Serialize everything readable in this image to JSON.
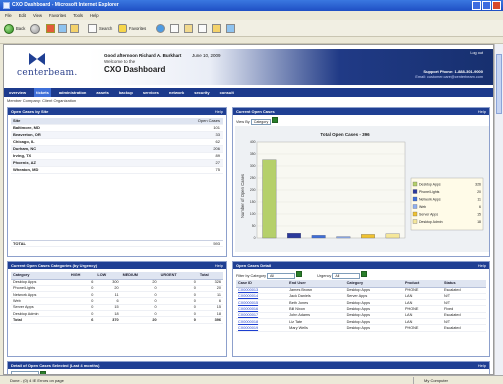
{
  "window": {
    "title": "CXO Dashboard - Microsoft Internet Explorer",
    "menu": [
      "File",
      "Edit",
      "View",
      "Favorites",
      "Tools",
      "Help"
    ]
  },
  "toolbar": {
    "back": "Back",
    "search": "Search",
    "favorites": "Favorites"
  },
  "header": {
    "logo": "centerbeam.",
    "greeting": "Good afternoon Richard A. Burkhart",
    "date": "June 10, 2009",
    "welcome": "Welcome to the",
    "title": "CXO Dashboard",
    "logout": "Log out",
    "support": "Support Phone: 1-888-301-9000",
    "email": "Email: customer.care@centerbeam.com"
  },
  "nav": [
    "overview",
    "tickets",
    "administration",
    "assets",
    "backup",
    "services",
    "network",
    "security",
    "consult"
  ],
  "breadcrumb": "Member Company: Client Organization",
  "panels": {
    "by_site": {
      "title": "Open Cases by Site",
      "help": "Help",
      "col_site": "Site",
      "col_count": "Open Cases",
      "rows": [
        {
          "site": "Baltimore, MD",
          "count": "101"
        },
        {
          "site": "Beaverton, OR",
          "count": "33"
        },
        {
          "site": "Chicago, IL",
          "count": "62"
        },
        {
          "site": "Durham, NC",
          "count": "206"
        },
        {
          "site": "Irving, TX",
          "count": "89"
        },
        {
          "site": "Phoenix, AZ",
          "count": "27"
        },
        {
          "site": "Wheaton, MD",
          "count": "75"
        }
      ],
      "total_label": "TOTAL",
      "total_value": "593"
    },
    "current_cases": {
      "title": "Current Open Cases",
      "help": "Help",
      "filter_label": "View By",
      "filter_value": "Category",
      "chart_title": "Total Open Cases - 396"
    },
    "by_category": {
      "title": "Current Open Cases Categories (by Urgency)",
      "help": "Help",
      "columns": [
        "Category",
        "HIGH",
        "LOW",
        "MEDIUM",
        "URGENT",
        "Total"
      ],
      "rows": [
        [
          "Desktop Apps",
          "6",
          "300",
          "20",
          "0",
          "326"
        ],
        [
          "Phone/Lights",
          "0",
          "20",
          "0",
          "0",
          "20"
        ],
        [
          "Network Apps",
          "0",
          "11",
          "0",
          "0",
          "11"
        ],
        [
          "Web",
          "0",
          "6",
          "0",
          "0",
          "6"
        ],
        [
          "Server Apps",
          "0",
          "15",
          "0",
          "0",
          "15"
        ],
        [
          "Desktop Admin",
          "0",
          "18",
          "0",
          "0",
          "18"
        ]
      ],
      "total": [
        "Total",
        "6",
        "370",
        "20",
        "0",
        "396"
      ]
    },
    "detail": {
      "title": "Open Cases Detail",
      "help": "Help",
      "filter1_label": "Filter by Category",
      "filter1_value": "All",
      "filter2_label": "Urgency",
      "filter2_value": "All",
      "columns": [
        "Case ID",
        "End User",
        "Category",
        "Product",
        "Status"
      ],
      "rows": [
        [
          "CX0000013",
          "James Brown",
          "Desktop Apps",
          "PHONE",
          "Escalated"
        ],
        [
          "CX0000014",
          "Jack Daniels",
          "Server Apps",
          "LAN",
          "N/T"
        ],
        [
          "CX0000015",
          "Beth Jones",
          "Desktop Apps",
          "LAN",
          "N/T"
        ],
        [
          "CX0000016",
          "Bill Nixon",
          "Desktop Apps",
          "PHONE",
          "Fixed"
        ],
        [
          "CX0000017",
          "John Adams",
          "Desktop Apps",
          "LAN",
          "Escalated"
        ],
        [
          "CX0000018",
          "Liz Tate",
          "Desktop Apps",
          "LAN",
          "N/T"
        ],
        [
          "CX0000019",
          "Mary Wells",
          "Desktop Apps",
          "PHONE",
          "Escalated"
        ]
      ]
    },
    "summary": {
      "title": "Detail of Open Cases Selected (Last 4 months)",
      "help": "Help"
    }
  },
  "status": {
    "text": "Done - (0) 4 IE Errors on page",
    "zone": "My Computer"
  },
  "chart_data": {
    "type": "bar",
    "title": "Total Open Cases - 396",
    "ylabel": "Number of Open Cases",
    "ylim": [
      0,
      400
    ],
    "yticks": [
      0,
      50,
      100,
      150,
      200,
      250,
      300,
      350,
      400
    ],
    "categories": [
      "Desktop Apps",
      "Phone/Lights",
      "Network Apps",
      "Web",
      "Server Apps",
      "Desktop Admin"
    ],
    "values": [
      326,
      20,
      11,
      6,
      15,
      18
    ],
    "colors": [
      "#b5d06a",
      "#2b3a9b",
      "#3f6fd8",
      "#8fb0f0",
      "#f0c230",
      "#f5e79a"
    ]
  }
}
